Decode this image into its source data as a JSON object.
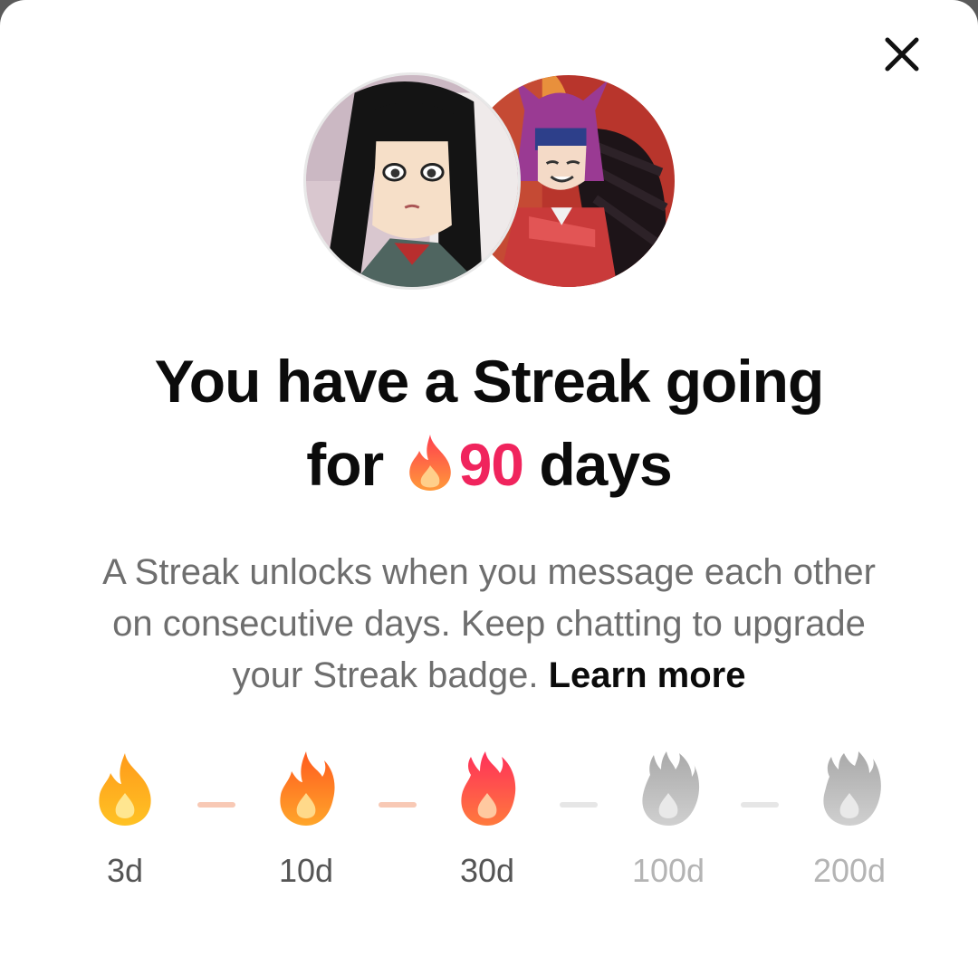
{
  "dialog": {
    "close_label": "Close",
    "title_line1": "You have a Streak going",
    "title_for": "for",
    "streak_count": "90",
    "title_days": "days",
    "description": "A Streak unlocks when you message each other on consecutive days. Keep chatting to upgrade your Streak badge.",
    "learn_more": "Learn more"
  },
  "milestones": [
    {
      "label": "3d",
      "unlocked": true
    },
    {
      "label": "10d",
      "unlocked": true
    },
    {
      "label": "30d",
      "unlocked": true
    },
    {
      "label": "100d",
      "unlocked": false
    },
    {
      "label": "200d",
      "unlocked": false
    }
  ],
  "colors": {
    "accent": "#f0245d",
    "title": "#0b0b0b",
    "body_text": "#6e6e6e",
    "locked_label": "#b4b4b4",
    "dash_active": "#f8c9b5",
    "dash_inactive": "#e6e6e6"
  },
  "icons": [
    "close-icon",
    "fire-icon",
    "fire-3d-icon",
    "fire-10d-icon",
    "fire-30d-icon",
    "fire-100d-locked-icon",
    "fire-200d-locked-icon"
  ]
}
